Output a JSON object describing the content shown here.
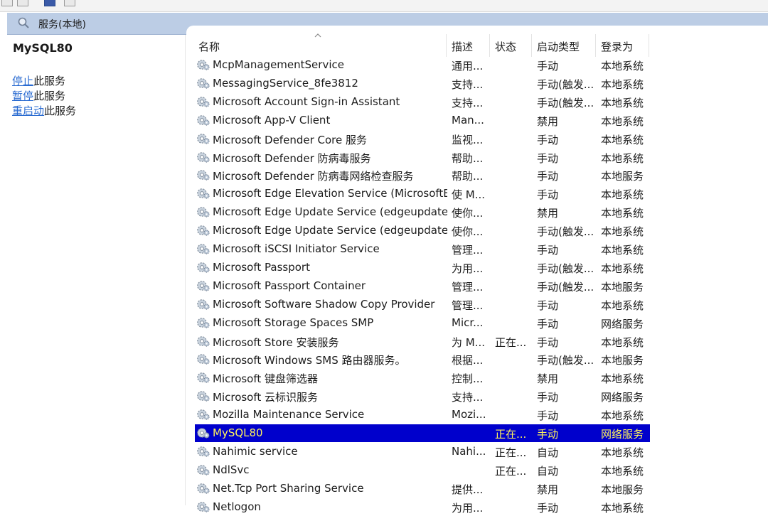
{
  "header": {
    "title": "服务(本地)"
  },
  "left": {
    "service_name": "MySQL80",
    "actions": [
      {
        "link": "停止",
        "suffix": "此服务"
      },
      {
        "link": "暂停",
        "suffix": "此服务"
      },
      {
        "link": "重启动",
        "suffix": "此服务"
      }
    ]
  },
  "columns": {
    "name": "名称",
    "desc": "描述",
    "status": "状态",
    "startup": "启动类型",
    "logon": "登录为"
  },
  "services": [
    {
      "name": "McpManagementService",
      "desc": "通用...",
      "status": "",
      "startup": "手动",
      "logon": "本地系统"
    },
    {
      "name": "MessagingService_8fe3812",
      "desc": "支持...",
      "status": "",
      "startup": "手动(触发...",
      "logon": "本地系统"
    },
    {
      "name": "Microsoft Account Sign-in Assistant",
      "desc": "支持...",
      "status": "",
      "startup": "手动(触发...",
      "logon": "本地系统"
    },
    {
      "name": "Microsoft App-V Client",
      "desc": "Man...",
      "status": "",
      "startup": "禁用",
      "logon": "本地系统"
    },
    {
      "name": "Microsoft Defender Core 服务",
      "desc": "监视...",
      "status": "",
      "startup": "手动",
      "logon": "本地系统"
    },
    {
      "name": "Microsoft Defender 防病毒服务",
      "desc": "帮助...",
      "status": "",
      "startup": "手动",
      "logon": "本地系统"
    },
    {
      "name": "Microsoft Defender 防病毒网络检查服务",
      "desc": "帮助...",
      "status": "",
      "startup": "手动",
      "logon": "本地服务"
    },
    {
      "name": "Microsoft Edge Elevation Service (MicrosoftEdg...",
      "desc": "使 M...",
      "status": "",
      "startup": "手动",
      "logon": "本地系统"
    },
    {
      "name": "Microsoft Edge Update Service (edgeupdate)",
      "desc": "使你...",
      "status": "",
      "startup": "禁用",
      "logon": "本地系统"
    },
    {
      "name": "Microsoft Edge Update Service (edgeupdatem)",
      "desc": "使你...",
      "status": "",
      "startup": "手动(触发...",
      "logon": "本地系统"
    },
    {
      "name": "Microsoft iSCSI Initiator Service",
      "desc": "管理...",
      "status": "",
      "startup": "手动",
      "logon": "本地系统"
    },
    {
      "name": "Microsoft Passport",
      "desc": "为用...",
      "status": "",
      "startup": "手动(触发...",
      "logon": "本地系统"
    },
    {
      "name": "Microsoft Passport Container",
      "desc": "管理...",
      "status": "",
      "startup": "手动(触发...",
      "logon": "本地服务"
    },
    {
      "name": "Microsoft Software Shadow Copy Provider",
      "desc": "管理...",
      "status": "",
      "startup": "手动",
      "logon": "本地系统"
    },
    {
      "name": "Microsoft Storage Spaces SMP",
      "desc": "Micr...",
      "status": "",
      "startup": "手动",
      "logon": "网络服务"
    },
    {
      "name": "Microsoft Store 安装服务",
      "desc": "为 M...",
      "status": "正在...",
      "startup": "手动",
      "logon": "本地系统"
    },
    {
      "name": "Microsoft Windows SMS 路由器服务。",
      "desc": "根据...",
      "status": "",
      "startup": "手动(触发...",
      "logon": "本地服务"
    },
    {
      "name": "Microsoft 键盘筛选器",
      "desc": "控制...",
      "status": "",
      "startup": "禁用",
      "logon": "本地系统"
    },
    {
      "name": "Microsoft 云标识服务",
      "desc": "支持...",
      "status": "",
      "startup": "手动",
      "logon": "网络服务"
    },
    {
      "name": "Mozilla Maintenance Service",
      "desc": "Mozi...",
      "status": "",
      "startup": "手动",
      "logon": "本地系统"
    },
    {
      "name": "MySQL80",
      "desc": "",
      "status": "正在...",
      "startup": "手动",
      "logon": "网络服务",
      "selected": true
    },
    {
      "name": "Nahimic service",
      "desc": "Nahi...",
      "status": "正在...",
      "startup": "自动",
      "logon": "本地系统"
    },
    {
      "name": "NdlSvc",
      "desc": "",
      "status": "正在...",
      "startup": "自动",
      "logon": "本地系统"
    },
    {
      "name": "Net.Tcp Port Sharing Service",
      "desc": "提供...",
      "status": "",
      "startup": "禁用",
      "logon": "本地服务"
    },
    {
      "name": "Netlogon",
      "desc": "为用...",
      "status": "",
      "startup": "手动",
      "logon": "本地系统"
    }
  ]
}
